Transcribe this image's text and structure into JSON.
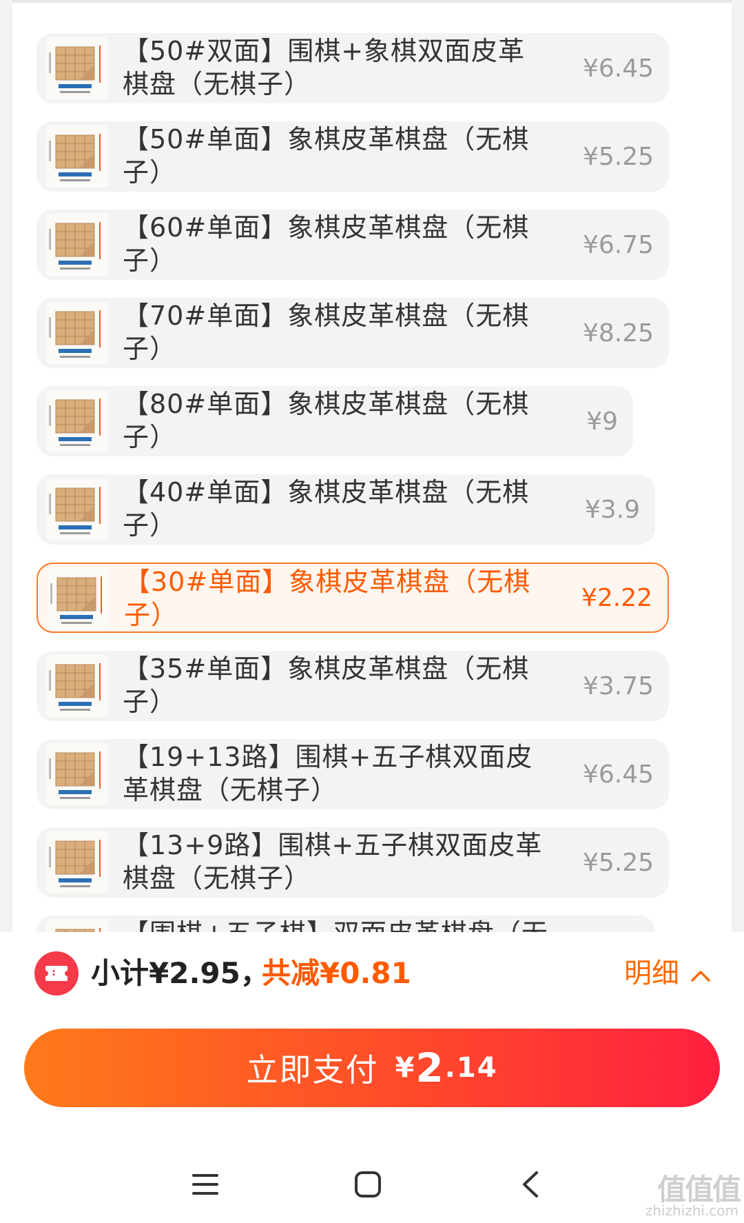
{
  "options": [
    {
      "label": "【50#双面】围棋+象棋双面皮革棋盘（无棋子）",
      "price": "¥6.45",
      "selected": false
    },
    {
      "label": "【50#单面】象棋皮革棋盘（无棋子）",
      "price": "¥5.25",
      "selected": false
    },
    {
      "label": "【60#单面】象棋皮革棋盘（无棋子）",
      "price": "¥6.75",
      "selected": false
    },
    {
      "label": "【70#单面】象棋皮革棋盘（无棋子）",
      "price": "¥8.25",
      "selected": false
    },
    {
      "label": "【80#单面】象棋皮革棋盘（无棋子）",
      "price": "¥9",
      "selected": false
    },
    {
      "label": "【40#单面】象棋皮革棋盘（无棋子）",
      "price": "¥3.9",
      "selected": false
    },
    {
      "label": "【30#单面】象棋皮革棋盘（无棋子）",
      "price": "¥2.22",
      "selected": true
    },
    {
      "label": "【35#单面】象棋皮革棋盘（无棋子）",
      "price": "¥3.75",
      "selected": false
    },
    {
      "label": "【19+13路】围棋+五子棋双面皮革棋盘（无棋子）",
      "price": "¥6.45",
      "selected": false
    },
    {
      "label": "【13+9路】围棋+五子棋双面皮革棋盘（无棋子）",
      "price": "¥5.25",
      "selected": false
    },
    {
      "label": "【围棋+五子棋】双面皮革棋盘（无",
      "price": "",
      "selected": false
    }
  ],
  "summary": {
    "subtotal": "小计¥2.95，",
    "discount": "共减¥0.81",
    "detail_label": "明细"
  },
  "pay_button": {
    "label": "立即支付",
    "currency": "¥",
    "amount_int": "2",
    "amount_dec": ".14"
  },
  "watermark": {
    "text": "值值值",
    "url": "zhizhizhi.com"
  },
  "colors": {
    "accent": "#ff5a00",
    "pay_gradient_start": "#ff7a1a",
    "pay_gradient_end": "#ff2040",
    "coupon_icon": "#f53a4a"
  },
  "icons": {
    "coupon": "ticket-icon",
    "detail": "chevron-up-icon",
    "nav_recent": "menu-lines-icon",
    "nav_home": "rounded-square-icon",
    "nav_back": "chevron-left-icon"
  }
}
